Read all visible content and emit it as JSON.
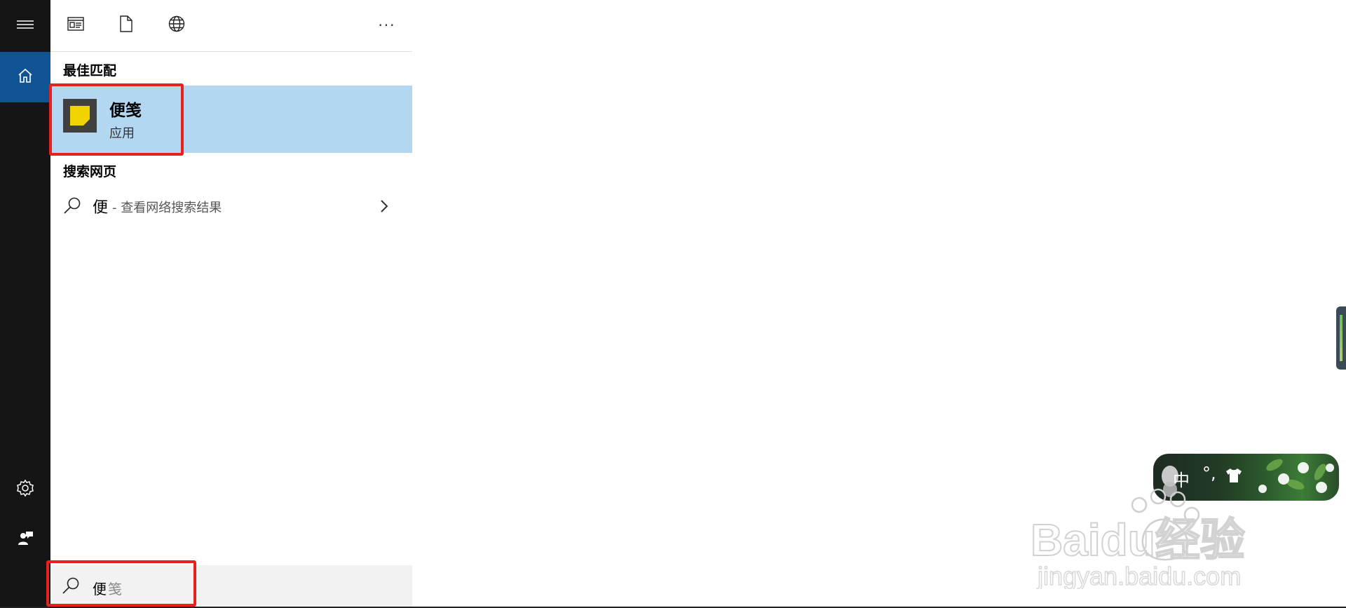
{
  "rail": {
    "items": [
      "menu-icon",
      "home-icon",
      "settings-icon",
      "feedback-icon"
    ]
  },
  "filters": {
    "icons": [
      "apps-icon",
      "documents-icon",
      "web-icon"
    ],
    "more_label": "···"
  },
  "best_match": {
    "header": "最佳匹配",
    "app_name": "便笺",
    "app_type": "应用"
  },
  "web_search": {
    "header": "搜索网页",
    "query": "便",
    "suffix": " - 查看网络搜索结果"
  },
  "search": {
    "typed": "便",
    "suggestion": "笺"
  },
  "ime": {
    "mode": "中",
    "punct": "°,"
  },
  "watermark": {
    "brand": "Baidu经验",
    "url": "jingyan.baidu.com"
  },
  "colors": {
    "rail_bg": "#151515",
    "rail_active": "#0f5394",
    "best_match_bg": "#b3d7f1",
    "highlight_border": "#e8201e",
    "search_bg": "#f2f2f2"
  }
}
